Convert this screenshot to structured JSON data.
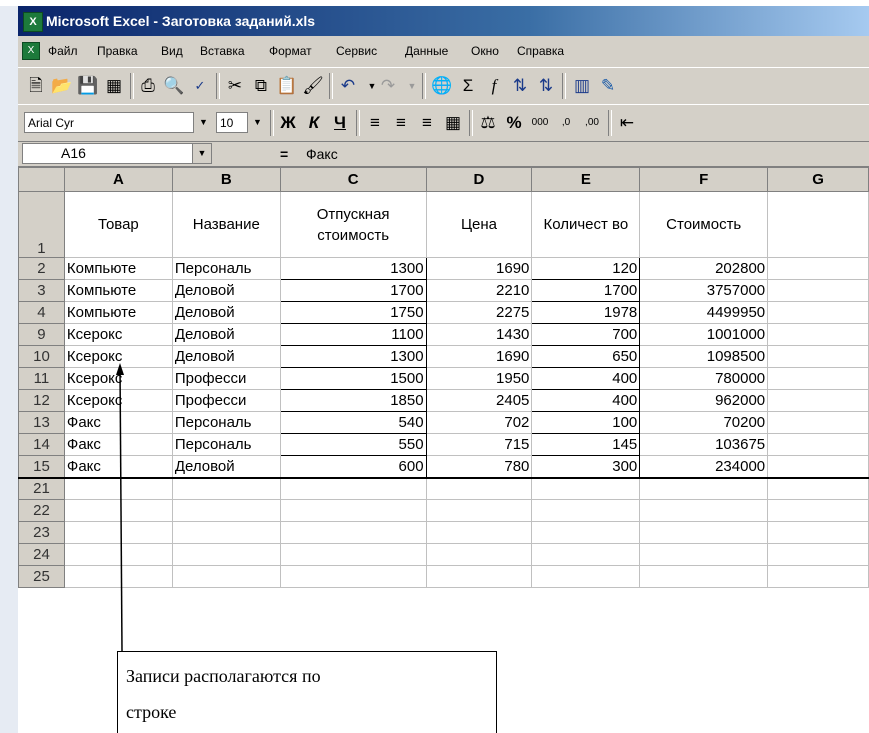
{
  "window": {
    "title": "Microsoft Excel - Заготовка заданий.xls"
  },
  "menu": [
    "Файл",
    "Правка",
    "Вид",
    "Вставка",
    "Формат",
    "Сервис",
    "Данные",
    "Окно",
    "Справка"
  ],
  "toolbar2": {
    "font_name": "Arial Cyr",
    "font_size": "10"
  },
  "formula_bar": {
    "cell_ref": "A16",
    "equals": "=",
    "value": "Факс"
  },
  "sheet": {
    "columns": [
      "A",
      "B",
      "C",
      "D",
      "E",
      "F",
      "G"
    ],
    "header_row": {
      "row": "1",
      "cells": [
        "Товар",
        "Название",
        "Отпускная стоимость",
        "Цена",
        "Количест во",
        "Стоимость",
        ""
      ]
    },
    "rows": [
      {
        "row": "2",
        "cells": [
          "Компьюте",
          "Персональ",
          "1300",
          "1690",
          "120",
          "202800",
          ""
        ]
      },
      {
        "row": "3",
        "cells": [
          "Компьюте",
          "Деловой",
          "1700",
          "2210",
          "1700",
          "3757000",
          ""
        ]
      },
      {
        "row": "4",
        "cells": [
          "Компьюте",
          "Деловой",
          "1750",
          "2275",
          "1978",
          "4499950",
          ""
        ]
      },
      {
        "row": "9",
        "cells": [
          "Ксерокс",
          "Деловой",
          "1100",
          "1430",
          "700",
          "1001000",
          ""
        ]
      },
      {
        "row": "10",
        "cells": [
          "Ксерокс",
          "Деловой",
          "1300",
          "1690",
          "650",
          "1098500",
          ""
        ]
      },
      {
        "row": "11",
        "cells": [
          "Ксерокс",
          "Професси",
          "1500",
          "1950",
          "400",
          "780000",
          ""
        ]
      },
      {
        "row": "12",
        "cells": [
          "Ксерокс",
          "Професси",
          "1850",
          "2405",
          "400",
          "962000",
          ""
        ]
      },
      {
        "row": "13",
        "cells": [
          "Факс",
          "Персональ",
          "540",
          "702",
          "100",
          "70200",
          ""
        ]
      },
      {
        "row": "14",
        "cells": [
          "Факс",
          "Персональ",
          "550",
          "715",
          "145",
          "103675",
          ""
        ]
      },
      {
        "row": "15",
        "cells": [
          "Факс",
          "Деловой",
          "600",
          "780",
          "300",
          "234000",
          ""
        ]
      }
    ],
    "empty_rows": [
      "21",
      "22",
      "23",
      "24",
      "25"
    ]
  },
  "annotation": {
    "line1": "Записи располагаются по",
    "line2": "строке"
  }
}
